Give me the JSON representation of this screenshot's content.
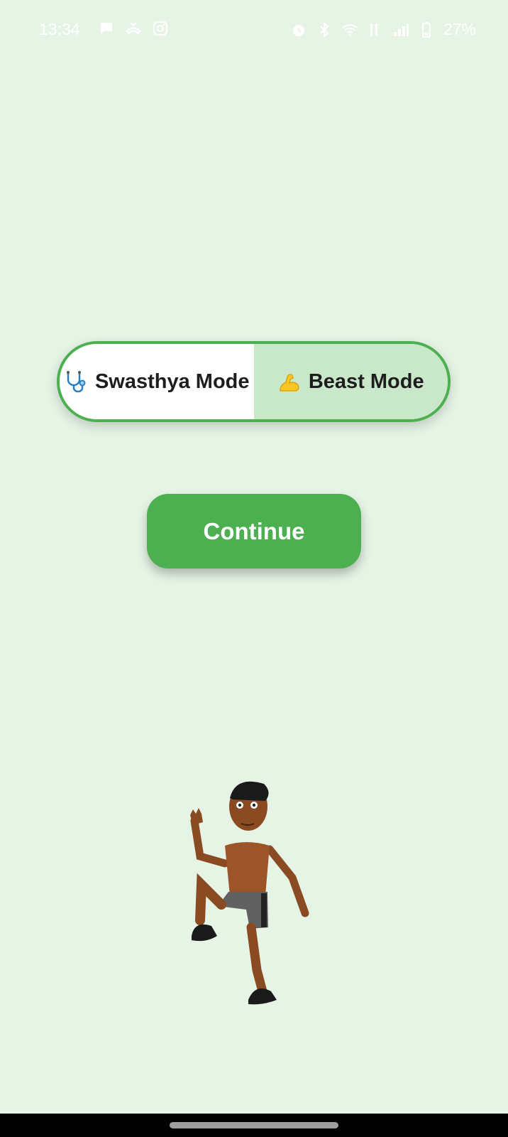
{
  "status_bar": {
    "time": "13:34",
    "battery": "27%",
    "left_icons": [
      "chat-bubble-icon",
      "missed-call-icon",
      "instagram-icon"
    ],
    "right_icons": [
      "alarm-icon",
      "bluetooth-icon",
      "wifi-icon",
      "volte-icon",
      "signal-icon",
      "battery-icon"
    ]
  },
  "mode_toggle": {
    "options": [
      {
        "label": "Swasthya Mode",
        "icon": "stethoscope-icon",
        "selected": false
      },
      {
        "label": "Beast Mode",
        "icon": "flexed-biceps-icon",
        "selected": true
      }
    ]
  },
  "continue_button": {
    "label": "Continue"
  },
  "mascot": {
    "description_icon": "exercising-man-illustration"
  },
  "colors": {
    "background": "#e6f4e6",
    "accent": "#4caf50",
    "selected_option": "#c9e7c9"
  }
}
